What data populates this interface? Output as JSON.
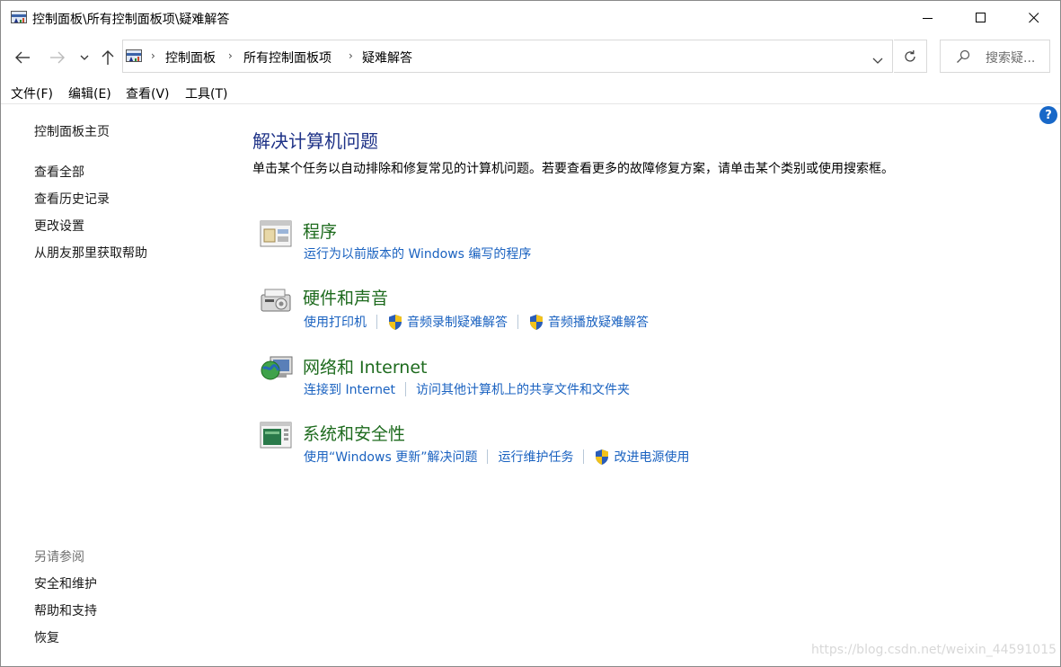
{
  "window": {
    "title": "控制面板\\所有控制面板项\\疑难解答"
  },
  "address_bar": {
    "crumbs": [
      "控制面板",
      "所有控制面板项",
      "疑难解答"
    ],
    "search_placeholder": "搜索疑..."
  },
  "menu": [
    "文件(F)",
    "编辑(E)",
    "查看(V)",
    "工具(T)"
  ],
  "sidebar": {
    "home": "控制面板主页",
    "links": [
      "查看全部",
      "查看历史记录",
      "更改设置",
      "从朋友那里获取帮助"
    ],
    "see_also_heading": "另请参阅",
    "see_also": [
      "安全和维护",
      "帮助和支持",
      "恢复"
    ]
  },
  "help_label": "?",
  "main": {
    "title": "解决计算机问题",
    "description": "单击某个任务以自动排除和修复常见的计算机问题。若要查看更多的故障修复方案，请单击某个类别或使用搜索框。",
    "categories": [
      {
        "title": "程序",
        "icon": "programs-icon",
        "links": [
          {
            "label": "运行为以前版本的 Windows 编写的程序",
            "shield": false
          }
        ]
      },
      {
        "title": "硬件和声音",
        "icon": "hardware-sound-icon",
        "links": [
          {
            "label": "使用打印机",
            "shield": false
          },
          {
            "label": "音频录制疑难解答",
            "shield": true
          },
          {
            "label": "音频播放疑难解答",
            "shield": true
          }
        ]
      },
      {
        "title": "网络和 Internet",
        "icon": "network-icon",
        "links": [
          {
            "label": "连接到 Internet",
            "shield": false
          },
          {
            "label": "访问其他计算机上的共享文件和文件夹",
            "shield": false
          }
        ]
      },
      {
        "title": "系统和安全性",
        "icon": "system-security-icon",
        "links": [
          {
            "label": "使用“Windows 更新”解决问题",
            "shield": false
          },
          {
            "label": "运行维护任务",
            "shield": false
          },
          {
            "label": "改进电源使用",
            "shield": true
          }
        ]
      }
    ]
  },
  "watermark": "https://blog.csdn.net/weixin_44591015",
  "colors": {
    "link": "#1a62c0",
    "category": "#1e6b1e",
    "heading": "#1e3287"
  }
}
